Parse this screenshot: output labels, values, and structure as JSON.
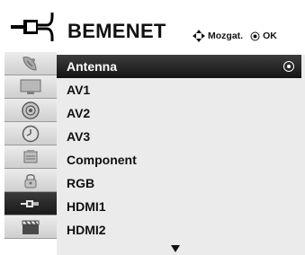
{
  "header": {
    "title": "BEMENET",
    "move_hint": "Mozgat.",
    "ok_hint": "OK"
  },
  "sidebar": {
    "items": [
      {
        "icon": "satellite-dish-icon",
        "active": false
      },
      {
        "icon": "monitor-icon",
        "active": false
      },
      {
        "icon": "speaker-icon",
        "active": false
      },
      {
        "icon": "clock-icon",
        "active": false
      },
      {
        "icon": "options-icon",
        "active": false
      },
      {
        "icon": "lock-icon",
        "active": false
      },
      {
        "icon": "input-plug-icon",
        "active": true
      },
      {
        "icon": "clapper-icon",
        "active": false
      }
    ]
  },
  "inputs": {
    "items": [
      {
        "label": "Antenna",
        "selected": true
      },
      {
        "label": "AV1",
        "selected": false
      },
      {
        "label": "AV2",
        "selected": false
      },
      {
        "label": "AV3",
        "selected": false
      },
      {
        "label": "Component",
        "selected": false
      },
      {
        "label": "RGB",
        "selected": false
      },
      {
        "label": "HDMI1",
        "selected": false
      },
      {
        "label": "HDMI2",
        "selected": false
      }
    ]
  },
  "colors": {
    "selected_bg": "#1f1f1f",
    "list_bg": "#ebebeb",
    "sidebar_bg": "#d9d9d9"
  }
}
